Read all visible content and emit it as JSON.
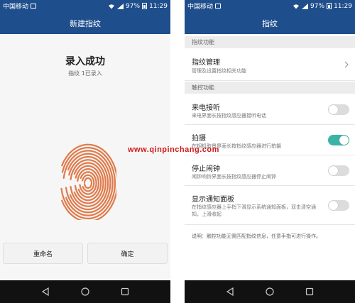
{
  "status_bar": {
    "carrier": "中国移动",
    "battery": "97%",
    "time": "11:29"
  },
  "left_screen": {
    "title": "新建指纹",
    "enroll_title": "录入成功",
    "enroll_subtitle": "指纹 1已录入",
    "fingerprint_color": "#e07a4a",
    "buttons": {
      "rename": "重命名",
      "confirm": "确定"
    }
  },
  "right_screen": {
    "title": "指纹",
    "section_fingerprint": "指纹功能",
    "manage_title": "指纹管理",
    "manage_desc": "管理及设置指纹相关功能",
    "section_touch": "触控功能",
    "items": [
      {
        "title": "来电接听",
        "desc": "来电界面长按指纹感应器接听电话",
        "on": false
      },
      {
        "title": "拍摄",
        "desc": "在相机取景界面长按指纹感应器进行拍摄",
        "on": true
      },
      {
        "title": "停止闹钟",
        "desc": "闹钟响铃界面长按指纹感应器停止闹钟",
        "on": false
      },
      {
        "title": "显示通知面板",
        "desc": "在指纹感应器上手指下滑显示系统通知面板，双击清空通知，上滑收起",
        "on": false
      }
    ],
    "note": "说明：触控功能无需匹配指纹信息，任意手指可进行操作。"
  },
  "watermark": "www.qinpinchang.com",
  "colors": {
    "primary": "#1f4e8c",
    "toggle_on": "#3bb3a6",
    "nav_bar": "#111111"
  }
}
